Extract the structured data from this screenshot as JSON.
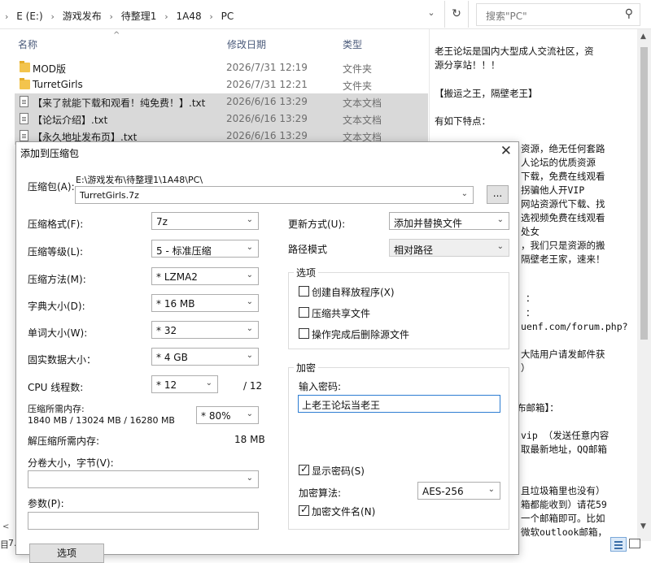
{
  "explorer": {
    "breadcrumbs": [
      "E (E:)",
      "游戏发布",
      "待整理1",
      "1A48",
      "PC"
    ],
    "search_placeholder": "搜索\"PC\"",
    "columns": {
      "name": "名称",
      "date": "修改日期",
      "type": "类型"
    },
    "files": [
      {
        "name": "MOD版",
        "date": "2026/7/31 12:19",
        "type": "文件夹",
        "kind": "folder",
        "selected": false
      },
      {
        "name": "TurretGirls",
        "date": "2026/7/31 12:21",
        "type": "文件夹",
        "kind": "folder",
        "selected": false
      },
      {
        "name": "【来了就能下载和观看！纯免费！】.txt",
        "date": "2026/6/16 13:29",
        "type": "文本文档",
        "kind": "txt",
        "selected": true
      },
      {
        "name": "【论坛介绍】.txt",
        "date": "2026/6/16 13:29",
        "type": "文本文档",
        "kind": "txt",
        "selected": true
      },
      {
        "name": "【永久地址发布页】.txt",
        "date": "2026/6/16 13:29",
        "type": "文本文档",
        "kind": "txt",
        "selected": true
      }
    ],
    "status_left": "7.",
    "status_j": "目"
  },
  "preview": {
    "lines": [
      "老王论坛是国内大型成人交流社区，资",
      "源分享站！！！",
      "【搬运之王，隔壁老王】",
      "有如下特点：",
      "资源，绝无任何套路",
      "人论坛的优质资源",
      "下载，免费在线观看",
      "拐骗他人开VIP",
      "网站资源代下载、找",
      "选视频免费在线观看",
      "处女",
      "，我们只是资源的搬",
      "隔壁老王家，速来！",
      "：",
      "：",
      "uenf.com/forum.php?",
      "大陆用户请发邮件获",
      "）",
      "布邮箱】：",
      "vip  （发送任意内容",
      "取最新地址，QQ邮箱",
      "且垃圾箱里也没有）",
      "箱都能收到）请花59",
      "一个邮箱即可。比如",
      "微软outlook邮箱，"
    ]
  },
  "dialog": {
    "title": "添加到压缩包",
    "archive_label": "压缩包(A):",
    "archive_path": "E:\\游戏发布\\待整理1\\1A48\\PC\\",
    "archive_name": "TurretGirls.7z",
    "browse_label": "...",
    "format_label": "压缩格式(F):",
    "format_value": "7z",
    "level_label": "压缩等级(L):",
    "level_value": "5 - 标准压缩",
    "method_label": "压缩方法(M):",
    "method_value": "* LZMA2",
    "dict_label": "字典大小(D):",
    "dict_value": "* 16 MB",
    "word_label": "单词大小(W):",
    "word_value": "* 32",
    "solid_label": "固实数据大小：",
    "solid_value": "* 4 GB",
    "threads_label": "CPU 线程数:",
    "threads_value": "* 12",
    "threads_total": "/ 12",
    "mem_comp_label": "压缩所需内存:",
    "mem_comp_detail": "1840 MB / 13024 MB / 16280 MB",
    "mem_comp_percent": "* 80%",
    "mem_decomp_label": "解压缩所需内存:",
    "mem_decomp_value": "18 MB",
    "split_label": "分卷大小，字节(V):",
    "split_value": "",
    "params_label": "参数(P):",
    "params_value": "",
    "options_button": "选项",
    "update_label": "更新方式(U):",
    "update_value": "添加并替换文件",
    "pathmode_label": "路径模式",
    "pathmode_value": "相对路径",
    "options_group": "选项",
    "opt_sfx": "创建自释放程序(X)",
    "opt_shared": "压缩共享文件",
    "opt_delete": "操作完成后删除源文件",
    "encrypt_group": "加密",
    "password_label": "输入密码:",
    "password_value": "上老王论坛当老王",
    "show_password": "显示密码(S)",
    "enc_method_label": "加密算法:",
    "enc_method_value": "AES-256",
    "encrypt_names": "加密文件名(N)"
  }
}
